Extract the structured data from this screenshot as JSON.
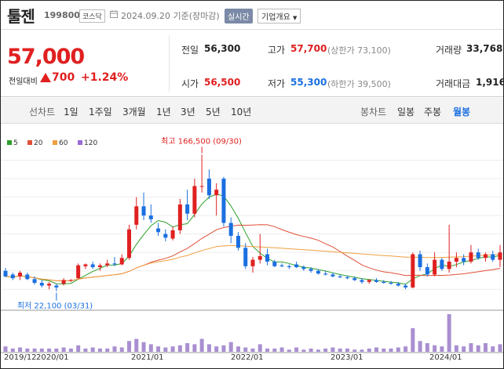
{
  "stock": {
    "name": "툴젠",
    "code": "199800",
    "market": "코스닥",
    "date_text": "2024.09.20 기준(장마감)",
    "realtime_label": "실시간",
    "info_label": "기업개요"
  },
  "price": {
    "current": "57,000",
    "change_label": "전일대비",
    "change_amount": "700",
    "change_rate": "+1.24%"
  },
  "quote": {
    "prev_close": {
      "label": "전일",
      "value": "56,300"
    },
    "high": {
      "label": "고가",
      "value": "57,700",
      "sub": "(상한가 73,100)"
    },
    "volume": {
      "label": "거래량",
      "value": "33,768"
    },
    "open": {
      "label": "시가",
      "value": "56,500"
    },
    "low": {
      "label": "저가",
      "value": "55,300",
      "sub": "(하한가 39,500)"
    },
    "amount": {
      "label": "거래대금",
      "value": "1,916"
    }
  },
  "tabs": {
    "line_chart": "선차트",
    "d1": "1일",
    "w1": "1주일",
    "m3": "3개월",
    "y1": "1년",
    "y3": "3년",
    "y5": "5년",
    "y10": "10년",
    "candle_chart": "봉차트",
    "daily": "일봉",
    "weekly": "주봉",
    "monthly": "월봉"
  },
  "colors": {
    "up": "#e02020",
    "down": "#1a6fe0",
    "ma5": "#2ca02c",
    "ma20": "#e0503a",
    "ma60": "#f0a040",
    "ma120": "#9b6bd3",
    "active_tab": "#1a6fe0"
  },
  "chart_data": {
    "type": "candlestick",
    "interval": "monthly",
    "legend": [
      "5",
      "20",
      "60",
      "120"
    ],
    "annotations": {
      "high": "최고 166,500 (09/30)",
      "low": "최저 22,100 (03/31)"
    },
    "x_ticks": [
      "2019/12",
      "2020/01",
      "2021/01",
      "2022/01",
      "2023/01",
      "2024/01"
    ],
    "series": [
      {
        "o": 40,
        "h": 43,
        "l": 33,
        "c": 34
      },
      {
        "o": 36,
        "h": 38,
        "l": 30,
        "c": 32
      },
      {
        "o": 34,
        "h": 40,
        "l": 30,
        "c": 38
      },
      {
        "o": 36,
        "h": 38,
        "l": 30,
        "c": 31
      },
      {
        "o": 31,
        "h": 34,
        "l": 25,
        "c": 27
      },
      {
        "o": 27,
        "h": 30,
        "l": 22,
        "c": 24
      },
      {
        "o": 24,
        "h": 28,
        "l": 20,
        "c": 26
      },
      {
        "o": 24,
        "h": 26,
        "l": 18,
        "c": 22
      },
      {
        "o": 26,
        "h": 32,
        "l": 24,
        "c": 30
      },
      {
        "o": 30,
        "h": 31,
        "l": 28,
        "c": 30
      },
      {
        "o": 32,
        "h": 48,
        "l": 31,
        "c": 46
      },
      {
        "o": 45,
        "h": 48,
        "l": 42,
        "c": 47
      },
      {
        "o": 47,
        "h": 50,
        "l": 42,
        "c": 44
      },
      {
        "o": 44,
        "h": 48,
        "l": 40,
        "c": 46
      },
      {
        "o": 46,
        "h": 52,
        "l": 44,
        "c": 48
      },
      {
        "o": 48,
        "h": 55,
        "l": 45,
        "c": 47
      },
      {
        "o": 47,
        "h": 58,
        "l": 46,
        "c": 54
      },
      {
        "o": 54,
        "h": 90,
        "l": 52,
        "c": 85
      },
      {
        "o": 90,
        "h": 120,
        "l": 85,
        "c": 110
      },
      {
        "o": 110,
        "h": 125,
        "l": 95,
        "c": 100
      },
      {
        "o": 100,
        "h": 112,
        "l": 92,
        "c": 96
      },
      {
        "o": 86,
        "h": 92,
        "l": 78,
        "c": 82
      },
      {
        "o": 80,
        "h": 85,
        "l": 72,
        "c": 76
      },
      {
        "o": 75,
        "h": 88,
        "l": 73,
        "c": 84
      },
      {
        "o": 84,
        "h": 118,
        "l": 80,
        "c": 112
      },
      {
        "o": 112,
        "h": 128,
        "l": 95,
        "c": 102
      },
      {
        "o": 102,
        "h": 140,
        "l": 98,
        "c": 132
      },
      {
        "o": 132,
        "h": 166,
        "l": 125,
        "c": 132
      },
      {
        "o": 140,
        "h": 150,
        "l": 118,
        "c": 122
      },
      {
        "o": 122,
        "h": 135,
        "l": 100,
        "c": 128
      },
      {
        "o": 140,
        "h": 142,
        "l": 88,
        "c": 92
      },
      {
        "o": 92,
        "h": 98,
        "l": 70,
        "c": 78
      },
      {
        "o": 78,
        "h": 82,
        "l": 62,
        "c": 65
      },
      {
        "o": 65,
        "h": 70,
        "l": 42,
        "c": 45
      },
      {
        "o": 45,
        "h": 55,
        "l": 38,
        "c": 52
      },
      {
        "o": 52,
        "h": 80,
        "l": 48,
        "c": 56
      },
      {
        "o": 58,
        "h": 64,
        "l": 46,
        "c": 50
      },
      {
        "o": 50,
        "h": 52,
        "l": 44,
        "c": 45
      },
      {
        "o": 46,
        "h": 48,
        "l": 44,
        "c": 45
      },
      {
        "o": 45,
        "h": 47,
        "l": 42,
        "c": 44
      },
      {
        "o": 47,
        "h": 50,
        "l": 43,
        "c": 44
      },
      {
        "o": 44,
        "h": 46,
        "l": 40,
        "c": 42
      },
      {
        "o": 42,
        "h": 44,
        "l": 38,
        "c": 40
      },
      {
        "o": 40,
        "h": 42,
        "l": 36,
        "c": 37
      },
      {
        "o": 37,
        "h": 40,
        "l": 35,
        "c": 36
      },
      {
        "o": 36,
        "h": 38,
        "l": 33,
        "c": 34
      },
      {
        "o": 34,
        "h": 36,
        "l": 32,
        "c": 33
      },
      {
        "o": 33,
        "h": 35,
        "l": 31,
        "c": 32
      },
      {
        "o": 32,
        "h": 34,
        "l": 29,
        "c": 30
      },
      {
        "o": 30,
        "h": 32,
        "l": 26,
        "c": 28
      },
      {
        "o": 28,
        "h": 31,
        "l": 26,
        "c": 30
      },
      {
        "o": 30,
        "h": 32,
        "l": 27,
        "c": 28
      },
      {
        "o": 28,
        "h": 30,
        "l": 26,
        "c": 27
      },
      {
        "o": 27,
        "h": 29,
        "l": 25,
        "c": 26
      },
      {
        "o": 26,
        "h": 28,
        "l": 23,
        "c": 24
      },
      {
        "o": 24,
        "h": 26,
        "l": 20,
        "c": 22
      },
      {
        "o": 22,
        "h": 60,
        "l": 21,
        "c": 58
      },
      {
        "o": 58,
        "h": 62,
        "l": 40,
        "c": 44
      },
      {
        "o": 44,
        "h": 48,
        "l": 34,
        "c": 36
      },
      {
        "o": 36,
        "h": 60,
        "l": 34,
        "c": 52
      },
      {
        "o": 52,
        "h": 54,
        "l": 40,
        "c": 42
      },
      {
        "o": 42,
        "h": 90,
        "l": 38,
        "c": 50
      },
      {
        "o": 50,
        "h": 60,
        "l": 44,
        "c": 54
      },
      {
        "o": 54,
        "h": 58,
        "l": 46,
        "c": 50
      },
      {
        "o": 50,
        "h": 68,
        "l": 48,
        "c": 60
      },
      {
        "o": 60,
        "h": 64,
        "l": 52,
        "c": 54
      },
      {
        "o": 54,
        "h": 60,
        "l": 50,
        "c": 58
      },
      {
        "o": 58,
        "h": 62,
        "l": 50,
        "c": 52
      },
      {
        "o": 52,
        "h": 68,
        "l": 44,
        "c": 60
      }
    ],
    "volumes": [
      5,
      3,
      4,
      3,
      3,
      3,
      3,
      3,
      4,
      3,
      6,
      3,
      4,
      3,
      3,
      5,
      4,
      10,
      12,
      9,
      7,
      5,
      4,
      5,
      6,
      8,
      7,
      12,
      7,
      5,
      6,
      9,
      5,
      4,
      3,
      7,
      3,
      3,
      4,
      2,
      4,
      2,
      3,
      2,
      3,
      4,
      3,
      3,
      2,
      2,
      3,
      4,
      3,
      3,
      4,
      5,
      22,
      10,
      8,
      6,
      5,
      35,
      6,
      5,
      8,
      6,
      8,
      5,
      7
    ],
    "ma_labels": [
      "5",
      "20",
      "60",
      "120"
    ]
  }
}
